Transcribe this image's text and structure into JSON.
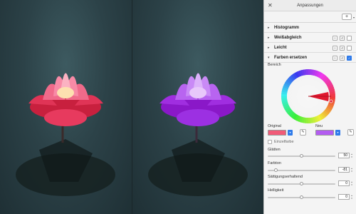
{
  "panel": {
    "title": "Anpassungen",
    "add_label": "+",
    "add_caret": "▾",
    "close_icon": "✕"
  },
  "sections": [
    {
      "label": "Histogramm"
    },
    {
      "label": "Weißabgleich"
    },
    {
      "label": "Leicht"
    },
    {
      "label": "Farben ersetzen"
    }
  ],
  "replace": {
    "range_label": "Bereich",
    "original_label": "Original",
    "new_label": "Neu",
    "original_color": "#f05b78",
    "new_color": "#b35cf0",
    "single_color_label": "Einzelfarbe"
  },
  "sliders": [
    {
      "label": "Glätten",
      "value": "50",
      "fraction": 0.5
    },
    {
      "label": "Farbton",
      "value": "-81",
      "fraction": 0.1
    },
    {
      "label": "Sättigungserhaltend",
      "value": "0",
      "fraction": 0.5
    },
    {
      "label": "Helligkeit",
      "value": "0",
      "fraction": 0.5
    }
  ],
  "colors": {
    "accent": "#2f7bea",
    "wheel_selection": "#e0182f"
  }
}
